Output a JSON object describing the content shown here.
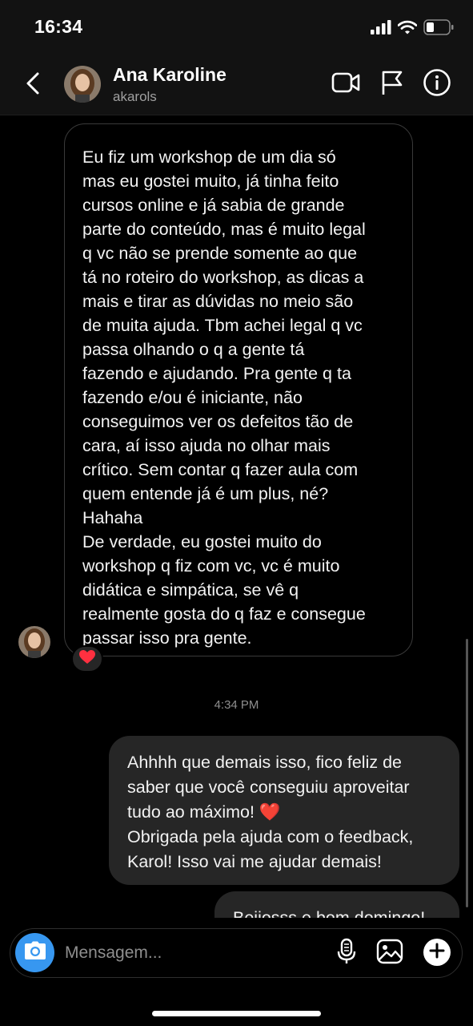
{
  "status_bar": {
    "time": "16:34",
    "icons": [
      "signal-icon",
      "wifi-icon",
      "battery-icon"
    ]
  },
  "header": {
    "name": "Ana Karoline",
    "handle": "akarols",
    "icons": [
      "back-chevron-icon",
      "video-call-icon",
      "flag-icon",
      "info-icon"
    ]
  },
  "messages": {
    "incoming": {
      "text": "Eu fiz um workshop de um dia só\nmas eu gostei muito, já tinha feito\ncursos online e já sabia de grande\nparte do conteúdo, mas é muito legal\nq vc não se prende somente ao que\ntá no roteiro do workshop, as dicas a\nmais e tirar as dúvidas no meio são\nde muita ajuda. Tbm achei legal q vc\npassa olhando o q a gente tá\nfazendo e ajudando. Pra gente q ta\nfazendo e/ou é iniciante, não\nconseguimos ver os defeitos tão de\ncara, aí isso ajuda no olhar mais\ncrítico. Sem contar q fazer aula com\nquem entende já é um plus, né?\nHahaha\nDe verdade, eu gostei muito do\nworkshop q fiz com vc, vc é muito\ndidática e simpática, se vê q\nrealmente gosta do q faz e consegue\npassar isso pra gente.",
      "reaction": "heart-reaction"
    },
    "timestamp": "4:34 PM",
    "outgoing": {
      "text": "Ahhhh que demais isso, fico feliz de\nsaber que você conseguiu aproveitar\ntudo ao máximo! ❤️\nObrigada pela ajuda com o feedback,\nKarol! Isso vai me ajudar demais!"
    },
    "outgoing_2": {
      "text": "Beijosss e bom domingo!"
    }
  },
  "composer": {
    "placeholder": "Mensagem...",
    "icons": [
      "camera-icon",
      "microphone-icon",
      "gallery-icon",
      "plus-icon"
    ]
  },
  "colors": {
    "background": "#000000",
    "header_bg": "#121212",
    "bubble_out": "#262626",
    "accent": "#3797f0",
    "heart": "#ff3040"
  }
}
